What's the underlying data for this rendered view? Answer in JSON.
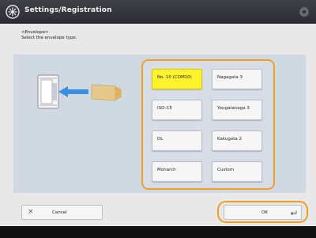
{
  "header": {
    "title": "Settings/Registration",
    "logo_icon": "settings-registration-icon",
    "settings_icon": "gear-icon"
  },
  "instruction": {
    "category": "<Envelope>",
    "text": "Select the envelope type."
  },
  "envelope_types": [
    {
      "label": "No. 10 (COM10)",
      "selected": true
    },
    {
      "label": "Nagagata 3",
      "selected": false
    },
    {
      "label": "ISO-C5",
      "selected": false
    },
    {
      "label": "Yougatanaga 3",
      "selected": false
    },
    {
      "label": "DL",
      "selected": false
    },
    {
      "label": "Kakugata 2",
      "selected": false
    },
    {
      "label": "Monarch",
      "selected": false
    },
    {
      "label": "Custom",
      "selected": false
    }
  ],
  "actions": {
    "cancel_label": "Cancel",
    "ok_label": "OK"
  },
  "colors": {
    "selected": "#fff32e",
    "highlight_frame": "#f0a020",
    "arrow": "#3b8ee0",
    "envelope": "#e6c98a",
    "titlebar": "#34353d"
  }
}
